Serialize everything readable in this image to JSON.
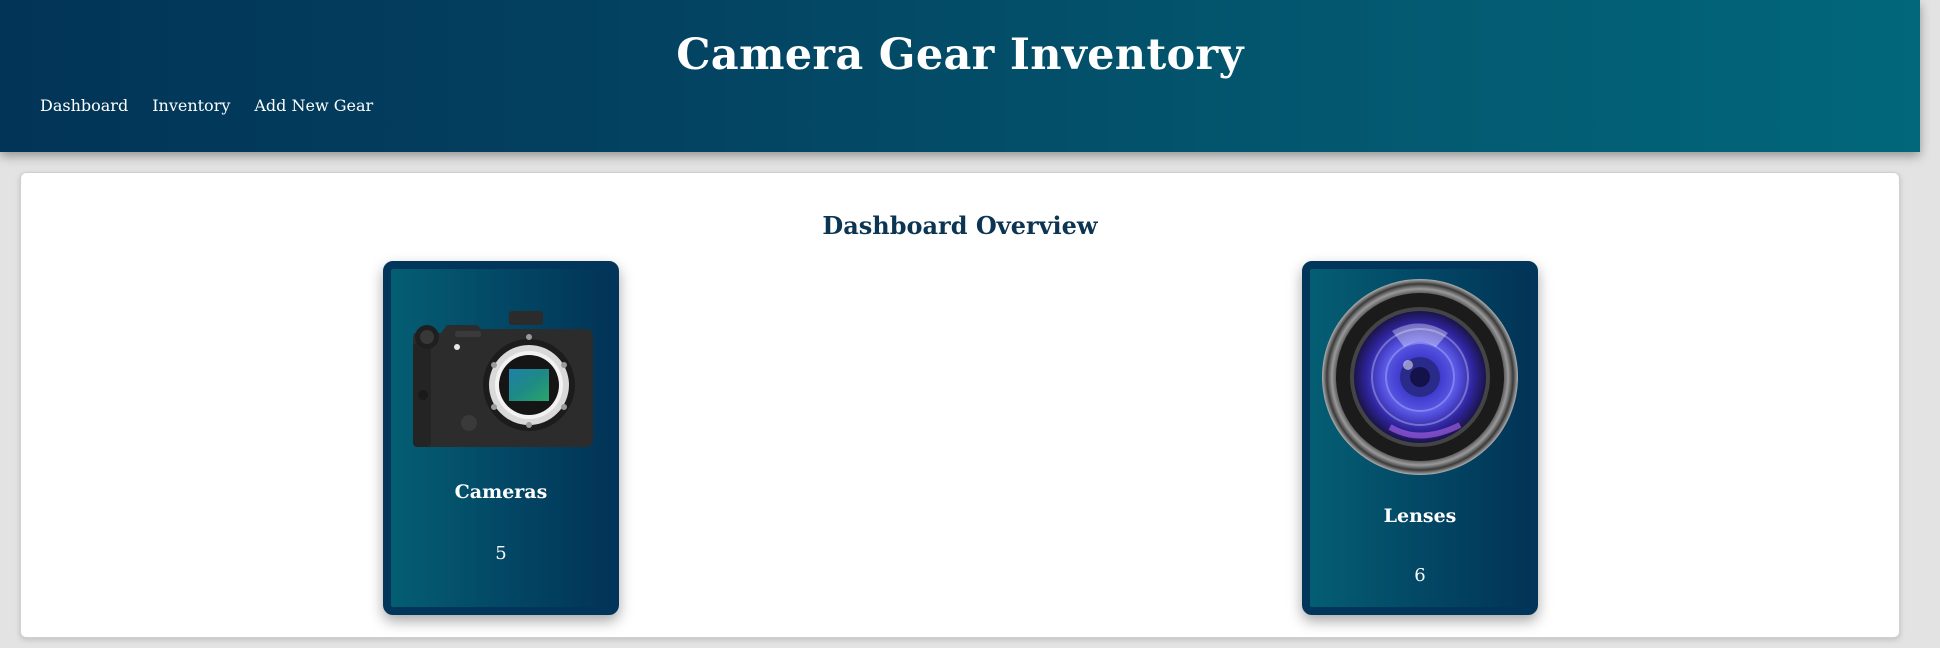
{
  "header": {
    "title": "Camera Gear Inventory",
    "nav": [
      {
        "label": "Dashboard"
      },
      {
        "label": "Inventory"
      },
      {
        "label": "Add New Gear"
      }
    ]
  },
  "main": {
    "section_title": "Dashboard Overview",
    "cards": [
      {
        "label": "Cameras",
        "count": "5",
        "icon": "camera-body-icon"
      },
      {
        "label": "Lenses",
        "count": "6",
        "icon": "camera-lens-icon"
      }
    ]
  },
  "colors": {
    "header_start": "#023457",
    "header_end": "#02677b",
    "card_border": "#02355a",
    "section_title": "#0b3553"
  }
}
